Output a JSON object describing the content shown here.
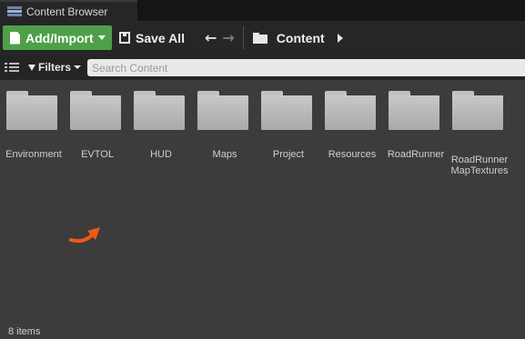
{
  "window": {
    "tab_title": "Content Browser"
  },
  "toolbar": {
    "add_import_label": "Add/Import",
    "save_all_label": "Save All",
    "path_label": "Content"
  },
  "filterbar": {
    "filters_label": "Filters",
    "search_placeholder": "Search Content"
  },
  "assets": [
    {
      "label": "Environment"
    },
    {
      "label": "EVTOL"
    },
    {
      "label": "HUD"
    },
    {
      "label": "Maps"
    },
    {
      "label": "Project"
    },
    {
      "label": "Resources"
    },
    {
      "label": "RoadRunner"
    },
    {
      "label": "RoadRunner MapTextures"
    }
  ],
  "status": {
    "item_count": "8 items"
  },
  "colors": {
    "add_button": "#4da048",
    "content_background": "#3c3c3c",
    "annotation_arrow": "#f05a14"
  }
}
